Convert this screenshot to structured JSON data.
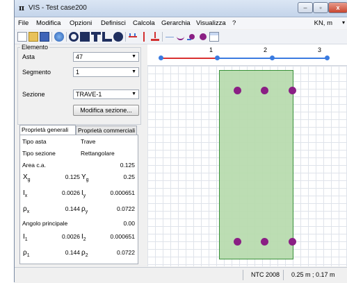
{
  "window": {
    "app_icon": "π",
    "title": "VIS - Test case200",
    "min_glyph": "–",
    "max_glyph": "▫",
    "close_glyph": "x"
  },
  "menu": {
    "items": [
      "File",
      "Modifica",
      "Opzioni",
      "Definisci",
      "Calcola",
      "Gerarchia",
      "Visualizza",
      "?"
    ],
    "units": "KN, m",
    "units_arrow": "▾"
  },
  "toolbar": {
    "icons": [
      "new-file-icon",
      "open-folder-icon",
      "save-icon",
      "help-icon",
      "circle-section-icon",
      "rectangle-section-icon",
      "t-section-icon",
      "l-section-icon",
      "circle-filled-icon",
      "beam-load-icon",
      "column-load-icon",
      "support-icon",
      "line-icon",
      "curve-icon",
      "rebar-tool-icon",
      "dot-icon",
      "table-icon"
    ]
  },
  "element_group": {
    "title": "Elemento",
    "asta_label": "Asta",
    "asta_value": "47",
    "segmento_label": "Segmento",
    "segmento_value": "1",
    "sezione_label": "Sezione",
    "sezione_value": "TRAVE-1",
    "edit_button": "Modifica sezione..."
  },
  "tabs": [
    "Proprietà generali",
    "Proprietà commerciali"
  ],
  "props": {
    "tipo_asta_label": "Tipo asta",
    "tipo_asta_value": "Trave",
    "tipo_sezione_label": "Tipo sezione",
    "tipo_sezione_value": "Rettangolare",
    "area_label": "Area c.a.",
    "area_value": "0.125",
    "xg_label": "X",
    "xg_sub": "g",
    "xg_value": "0.125",
    "yg_label": "Y",
    "yg_sub": "g",
    "yg_value": "0.25",
    "ix_label": "I",
    "ix_sub": "x",
    "ix_value": "0.0026",
    "iy_label": "I",
    "iy_sub": "y",
    "iy_value": "0.000651",
    "rx_label": "ρ",
    "rx_sub": "x",
    "rx_value": "0.144",
    "ry_label": "ρ",
    "ry_sub": "y",
    "ry_value": "0.0722",
    "angle_label": "Angolo principale",
    "angle_value": "0.00",
    "i1_label": "I",
    "i1_sub": "1",
    "i1_value": "0.0026",
    "i2_label": "I",
    "i2_sub": "2",
    "i2_value": "0.000651",
    "r1_label": "ρ",
    "r1_sub": "1",
    "r1_value": "0.144",
    "r2_label": "ρ",
    "r2_sub": "2",
    "r2_value": "0.0722"
  },
  "ruler": {
    "segments": [
      "1",
      "2",
      "3"
    ],
    "active_color": "#d93030",
    "inactive_color": "#3a7be0"
  },
  "status": {
    "norm": "NTC 2008",
    "coords": "0.25 m ; 0.17 m"
  },
  "colors": {
    "section_fill": "#b9dcaf",
    "section_border": "#2e8b2e",
    "rebar": "#8a1f84"
  }
}
